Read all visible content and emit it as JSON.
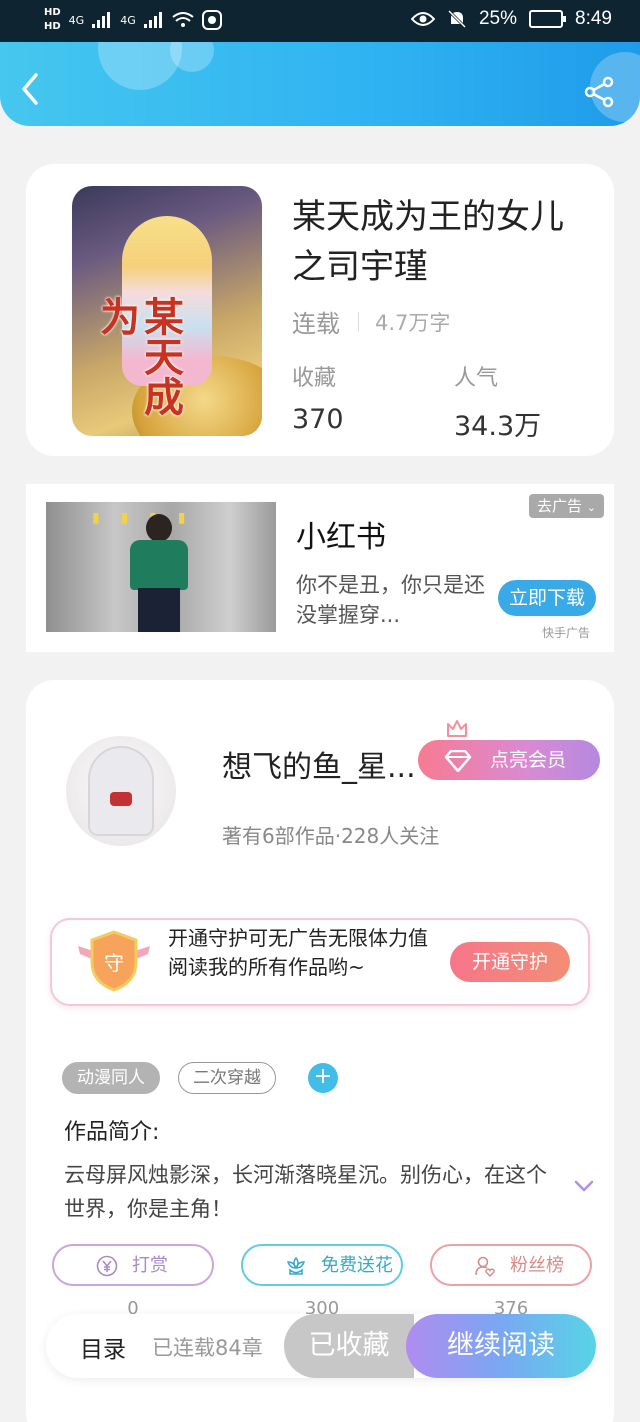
{
  "status_bar": {
    "network_1": "4G",
    "network_2": "4G",
    "battery": "25%",
    "time": "8:49"
  },
  "book": {
    "title": "某天成为王的女儿之司宇瑾",
    "status": "连载",
    "words": "4.7万字",
    "collect_label": "收藏",
    "collect_value": "370",
    "popularity_label": "人气",
    "popularity_value": "34.3万",
    "cover_text": "某天成为"
  },
  "ad": {
    "title": "小红书",
    "description": "你不是丑，你只是还没掌握穿...",
    "tag": "去广告",
    "button": "立即下载",
    "source": "快手广告"
  },
  "author": {
    "name": "想飞的鱼_星...",
    "stats": "著有6部作品·228人关注",
    "vip_button": "点亮会员",
    "guard_text": "开通守护可无广告无限体力值阅读我的所有作品哟~",
    "guard_shield": "守",
    "guard_button": "开通守护"
  },
  "tags": [
    "动漫同人",
    "二次穿越"
  ],
  "intro": {
    "title": "作品简介:",
    "text": "云母屏风烛影深，长河渐落晓星沉。别伤心，在这个世界，你是主角！"
  },
  "actions": [
    {
      "label": "打赏",
      "count": "0"
    },
    {
      "label": "免费送花",
      "count": "300"
    },
    {
      "label": "粉丝榜",
      "count": "376"
    }
  ],
  "bottom_bar": {
    "toc": "目录",
    "chapters": "已连载84章",
    "collected": "已收藏",
    "continue": "继续阅读"
  },
  "colors": {
    "header": "#2fb2f2",
    "vip": "#f87b92",
    "continue": "#7aa7f2"
  }
}
